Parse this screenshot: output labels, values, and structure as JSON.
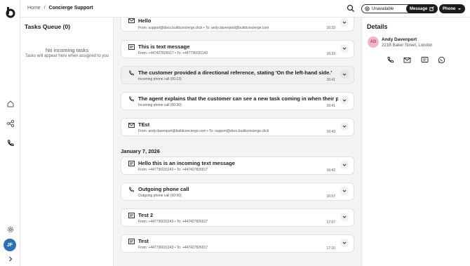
{
  "rail": {
    "avatar_initials": "JF"
  },
  "breadcrumb": {
    "home": "Home",
    "separator": "/",
    "current": "Concierge Support"
  },
  "header": {
    "status_label": "Unavailable",
    "message_label": "Message",
    "phone_label": "Phone"
  },
  "queue": {
    "title": "Tasks Queue (0)",
    "empty_title": "No incoming tasks",
    "empty_sub": "Tasks will appear here when assigned to you"
  },
  "feed": {
    "date_separator": "January 7, 2026",
    "cards": [
      {
        "icon": "email-icon",
        "title": "Hello",
        "meta": "From: support@docs.buildconcierge.click  •  To: andy.davenport@buildconcierge.com",
        "time": "16:33"
      },
      {
        "icon": "sms-icon",
        "title": "This is text message",
        "meta": "From: +447427826917  •  To: +447736031143",
        "time": "16:33"
      },
      {
        "icon": "phone-icon",
        "title": "The customer provided a directional reference, stating 'On the left-hand side.'",
        "meta": "Incoming phone call  (00:13)",
        "time": "16:41"
      },
      {
        "icon": "phone-icon",
        "title": "The agent explains that the customer can see a new task coming in when their p...",
        "meta": "Incoming phone call  (00:30)",
        "time": "16:41"
      },
      {
        "icon": "email-icon",
        "title": "TEst",
        "meta": "From: andy.davenport@buildconcierge.com  •  To: support@docs.buildconcierge.click",
        "time": "16:43"
      },
      {
        "icon": "sms-icon",
        "title": "Hello this is an incoming text message",
        "meta": "From: +447736031143  •  To: +447427826917",
        "time": "16:42"
      },
      {
        "icon": "phone-icon",
        "title": "Outgoing phone call",
        "meta": "Outgoing phone call  (00:00)",
        "time": "16:57"
      },
      {
        "icon": "sms-icon",
        "title": "Test 2",
        "meta": "From: +447736031143  •  To: +447427826917",
        "time": "17:07"
      },
      {
        "icon": "sms-icon",
        "title": "Test",
        "meta": "From: +447736031143  •  To: +447427826917",
        "time": "17:10"
      }
    ]
  },
  "details": {
    "title": "Details",
    "avatar_initials": "AD",
    "name": "Andy Davenport",
    "address": "221B Baker Street, London"
  },
  "colors": {
    "accent_dark": "#1c1c1c",
    "avatar_blue": "#2f6fb5",
    "avatar_pink": "#f3b6c7"
  }
}
